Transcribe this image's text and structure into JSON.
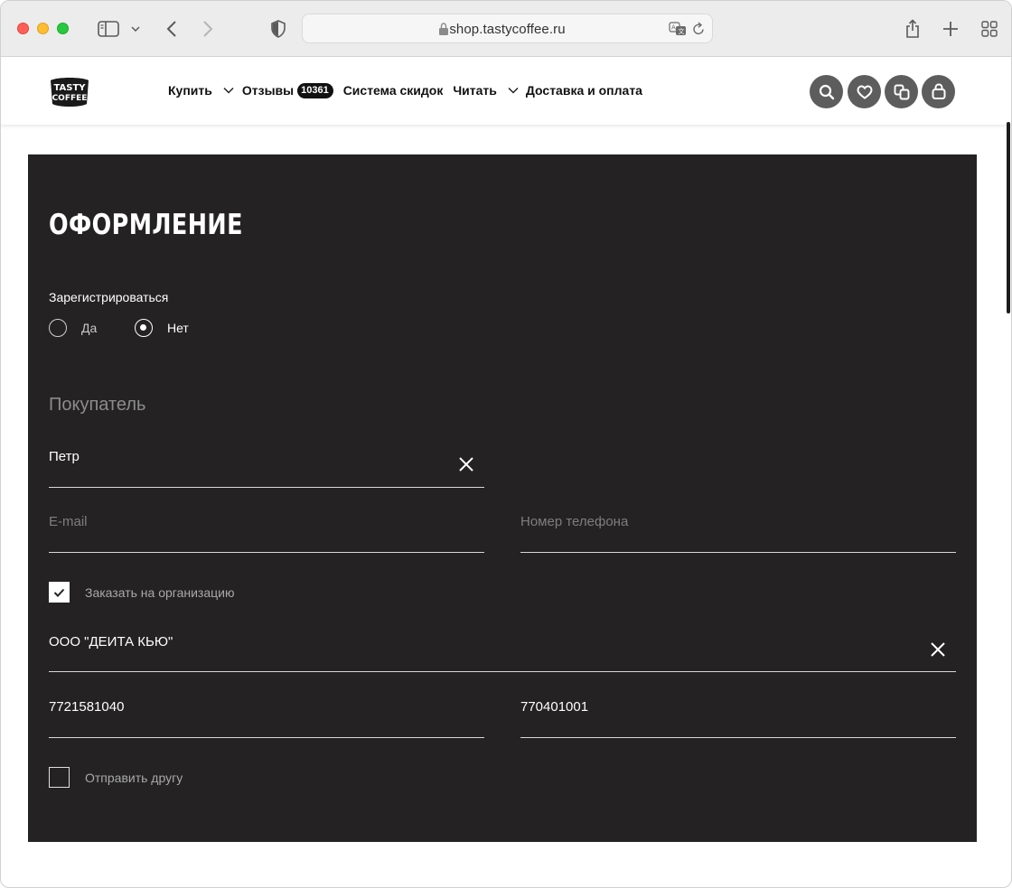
{
  "browser": {
    "url": "shop.tastycoffee.ru"
  },
  "header": {
    "logo_alt": "TASTY COFFEE",
    "nav": [
      {
        "label": "Купить",
        "has_caret": true
      },
      {
        "label": "Отзывы",
        "badge": "10361"
      },
      {
        "label": "Система скидок"
      },
      {
        "label": "Читать",
        "has_caret": true
      },
      {
        "label": "Доставка и оплата"
      }
    ],
    "icons": [
      "search-icon",
      "heart-icon",
      "compare-icon",
      "bag-icon"
    ]
  },
  "checkout": {
    "title": "ОФОРМЛЕНИЕ",
    "register_label": "Зарегистрироваться",
    "register_options": [
      {
        "label": "Да",
        "selected": false
      },
      {
        "label": "Нет",
        "selected": true
      }
    ],
    "buyer_section": "Покупатель",
    "name_value": "Петр",
    "email_placeholder": "E-mail",
    "phone_placeholder": "Номер телефона",
    "org_checkbox_label": "Заказать на организацию",
    "org_checked": true,
    "org_name_value": "ООО \"ДЕИТА КЬЮ\"",
    "inn_value": "7721581040",
    "kpp_value": "770401001",
    "friend_checkbox_label": "Отправить другу",
    "friend_checked": false
  },
  "colors": {
    "panel_bg": "#242223",
    "icon_circle": "#5d5d5d",
    "text_light": "#ffffff",
    "placeholder": "#7f7f7f"
  }
}
